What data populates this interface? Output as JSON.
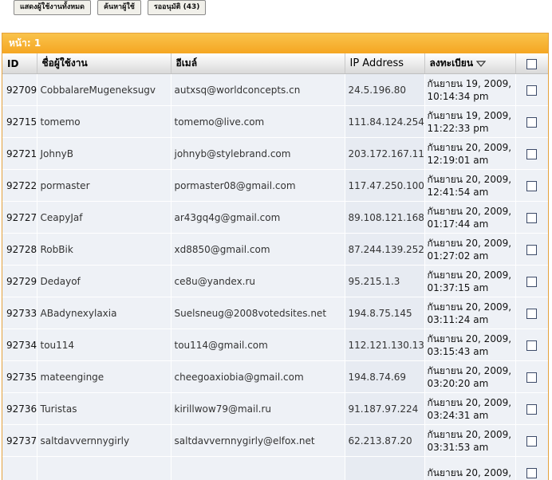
{
  "toolbar": {
    "show_all": "แสดงผู้ใช้งานทั้งหมด",
    "search_user": "ค้นหาผู้ใช้",
    "pending": "รออนุมัติ (43)"
  },
  "pagination": {
    "label": "หน้า: 1"
  },
  "columns": {
    "id": "ID",
    "username": "ชื่อผู้ใช้งาน",
    "email": "อีเมล์",
    "ip": "IP Address",
    "registered": "ลงทะเบียน"
  },
  "rows": [
    {
      "id": "92709",
      "username": "CobbalareMugeneksugv",
      "email": "autxsq@worldconcepts.cn",
      "ip": "24.5.196.80",
      "date": "กันยายน 19, 2009,",
      "time": "10:14:34 pm"
    },
    {
      "id": "92715",
      "username": "tomemo",
      "email": "tomemo@live.com",
      "ip": "111.84.124.254",
      "date": "กันยายน 19, 2009,",
      "time": "11:22:33 pm"
    },
    {
      "id": "92721",
      "username": "JohnyB",
      "email": "johnyb@stylebrand.com",
      "ip": "203.172.167.114",
      "date": "กันยายน 20, 2009,",
      "time": "12:19:01 am"
    },
    {
      "id": "92722",
      "username": "pormaster",
      "email": "pormaster08@gmail.com",
      "ip": "117.47.250.100",
      "date": "กันยายน 20, 2009,",
      "time": "12:41:54 am"
    },
    {
      "id": "92727",
      "username": "CeapyJaf",
      "email": "ar43gq4g@gmail.com",
      "ip": "89.108.121.168",
      "date": "กันยายน 20, 2009,",
      "time": "01:17:44 am"
    },
    {
      "id": "92728",
      "username": "RobBik",
      "email": "xd8850@gmail.com",
      "ip": "87.244.139.252",
      "date": "กันยายน 20, 2009,",
      "time": "01:27:02 am"
    },
    {
      "id": "92729",
      "username": "Dedayof",
      "email": "ce8u@yandex.ru",
      "ip": "95.215.1.3",
      "date": "กันยายน 20, 2009,",
      "time": "01:37:15 am"
    },
    {
      "id": "92733",
      "username": "ABadynexylaxia",
      "email": "Suelsneug@2008votedsites.net",
      "ip": "194.8.75.145",
      "date": "กันยายน 20, 2009,",
      "time": "03:11:24 am"
    },
    {
      "id": "92734",
      "username": "tou114",
      "email": "tou114@gmail.com",
      "ip": "112.121.130.134",
      "date": "กันยายน 20, 2009,",
      "time": "03:15:43 am"
    },
    {
      "id": "92735",
      "username": "mateenginge",
      "email": "cheegoaxiobia@gmail.com",
      "ip": "194.8.74.69",
      "date": "กันยายน 20, 2009,",
      "time": "03:20:20 am"
    },
    {
      "id": "92736",
      "username": "Turistas",
      "email": "kirillwow79@mail.ru",
      "ip": "91.187.97.224",
      "date": "กันยายน 20, 2009,",
      "time": "03:24:31 am"
    },
    {
      "id": "92737",
      "username": "saltdavvernnygirly",
      "email": "saltdavvernnygirly@elfox.net",
      "ip": "62.213.87.20",
      "date": "กันยายน 20, 2009,",
      "time": "03:31:53 am"
    },
    {
      "id": "",
      "username": "",
      "email": "",
      "ip": "",
      "date": "กันยายน 20, 2009,",
      "time": ""
    }
  ]
}
